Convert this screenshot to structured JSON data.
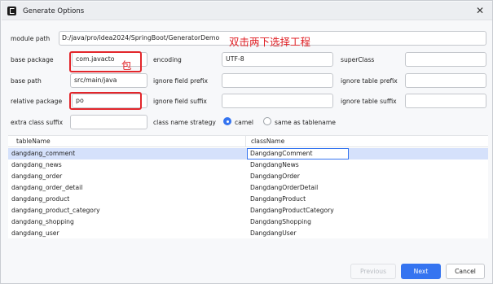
{
  "window": {
    "title": "Generate Options",
    "close_glyph": "✕"
  },
  "annotations": {
    "top_note": "双击两下选择工程",
    "package_note": "包"
  },
  "form": {
    "module_path": {
      "label": "module path",
      "value": "D:/java/pro/idea2024/SpringBoot/GeneratorDemo"
    },
    "base_package": {
      "label": "base package",
      "value": "com.javacto"
    },
    "encoding": {
      "label": "encoding",
      "value": "UTF-8"
    },
    "super_class": {
      "label": "superClass",
      "value": ""
    },
    "base_path": {
      "label": "base path",
      "value": "src/main/java"
    },
    "ignore_field_prefix": {
      "label": "ignore field prefix",
      "value": ""
    },
    "ignore_table_prefix": {
      "label": "ignore table prefix",
      "value": ""
    },
    "relative_package": {
      "label": "relative package",
      "value": "po"
    },
    "ignore_field_suffix": {
      "label": "ignore field suffix",
      "value": ""
    },
    "ignore_table_suffix": {
      "label": "ignore table suffix",
      "value": ""
    },
    "extra_class_suffix": {
      "label": "extra class suffix",
      "value": ""
    },
    "class_name_strategy": {
      "label": "class name strategy",
      "option_camel": "camel",
      "option_same": "same as tablename",
      "selected": "camel"
    }
  },
  "table": {
    "headers": {
      "table_name": "tableName",
      "class_name": "className"
    },
    "rows": [
      {
        "table_name": "dangdang_comment",
        "class_name": "DangdangComment"
      },
      {
        "table_name": "dangdang_news",
        "class_name": "DangdangNews"
      },
      {
        "table_name": "dangdang_order",
        "class_name": "DangdangOrder"
      },
      {
        "table_name": "dangdang_order_detail",
        "class_name": "DangdangOrderDetail"
      },
      {
        "table_name": "dangdang_product",
        "class_name": "DangdangProduct"
      },
      {
        "table_name": "dangdang_product_category",
        "class_name": "DangdangProductCategory"
      },
      {
        "table_name": "dangdang_shopping",
        "class_name": "DangdangShopping"
      },
      {
        "table_name": "dangdang_user",
        "class_name": "DangdangUser"
      }
    ],
    "selected_row": 0
  },
  "buttons": {
    "previous": "Previous",
    "next": "Next",
    "cancel": "Cancel"
  },
  "colors": {
    "accent": "#3574f0",
    "annotation_red": "#e3262b",
    "selection": "#d5e1fb"
  }
}
